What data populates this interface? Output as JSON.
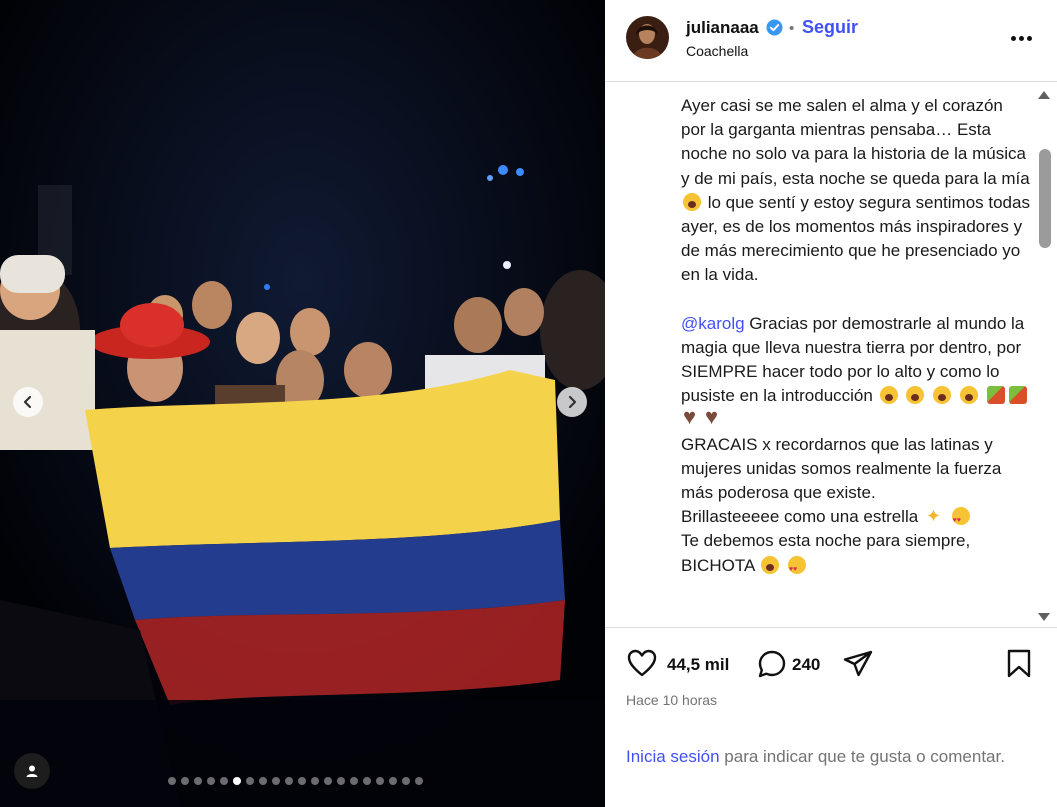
{
  "post": {
    "username": "julianaaa",
    "separator": "•",
    "follow_label": "Seguir",
    "location": "Coachella",
    "caption_p1": "Ayer casi se me salen el alma y el corazón por la garganta mientras pensaba… Esta noche no solo va para la historia de la música y de mi país, esta noche se queda para la mía",
    "caption_p1b": " lo que sentí y estoy segura sentimos todas ayer, es de los momentos más inspiradores y de más merecimiento que he presenciado yo en la vida.",
    "mention": "@karolg",
    "caption_p2": " Gracias por demostrarle al mundo la magia que lleva nuestra tierra por dentro, por SIEMPRE hacer todo por lo alto y como lo pusiste en la introducción",
    "caption_p3": "GRACAIS x recordarnos que las latinas y mujeres unidas somos realmente la fuerza más poderosa que existe.",
    "caption_p4": "Brillasteeeee como una estrella",
    "caption_p5": "Te debemos esta noche para siempre, BICHOTA",
    "likes": "44,5 mil",
    "comments": "240",
    "time": "Hace 10 horas"
  },
  "login": {
    "link": "Inicia sesión",
    "rest": " para indicar que te gusta o comentar."
  },
  "carousel": {
    "total": 20,
    "active_index": 5
  },
  "colors": {
    "accent": "#4150f7",
    "flag_yellow": "#f4d24a",
    "flag_blue": "#243c8e",
    "flag_red": "#c92a2a"
  },
  "icons": [
    "verified-badge-icon",
    "more-options-icon",
    "heart-icon",
    "comment-icon",
    "share-icon",
    "bookmark-icon",
    "user-tag-icon",
    "chevron-left-icon",
    "chevron-right-icon"
  ]
}
